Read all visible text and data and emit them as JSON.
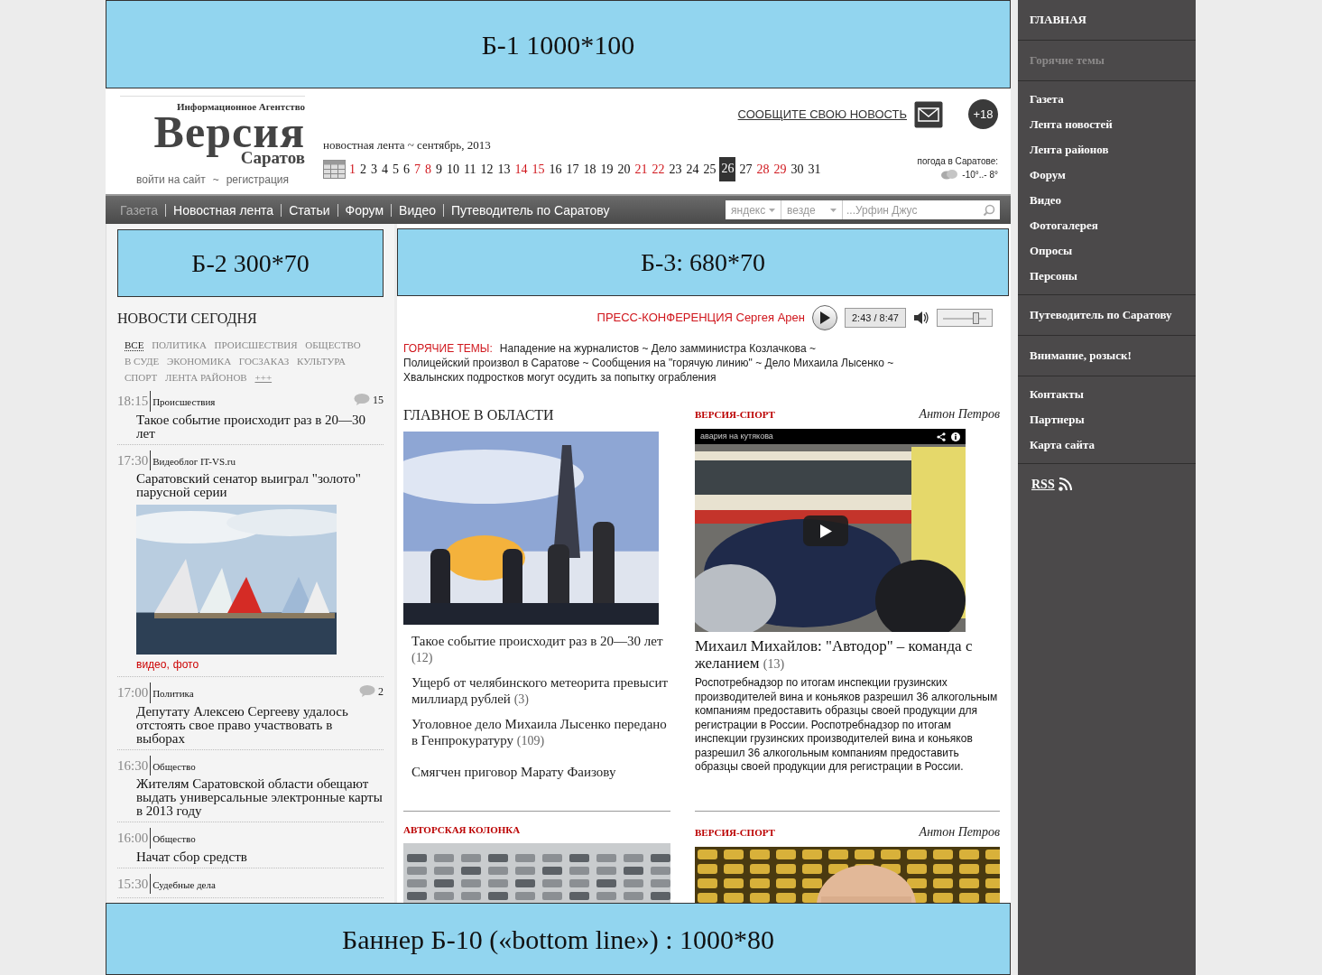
{
  "top_banner": {
    "text": "Б-1  1000*100"
  },
  "header": {
    "logo": {
      "tagline": "Информационное Агентство",
      "name": "Версия",
      "city": "Саратов"
    },
    "login": "войти на сайт",
    "login_separator": "~",
    "register": "регистрация",
    "feed_title": "новостная лента ~ сентябрь, 2013",
    "days": [
      {
        "label": "1",
        "weekend": true,
        "selected": false
      },
      {
        "label": "2",
        "weekend": false,
        "selected": false
      },
      {
        "label": "3",
        "weekend": false,
        "selected": false
      },
      {
        "label": "4",
        "weekend": false,
        "selected": false
      },
      {
        "label": "5",
        "weekend": false,
        "selected": false
      },
      {
        "label": "6",
        "weekend": false,
        "selected": false
      },
      {
        "label": "7",
        "weekend": true,
        "selected": false
      },
      {
        "label": "8",
        "weekend": true,
        "selected": false
      },
      {
        "label": "9",
        "weekend": false,
        "selected": false
      },
      {
        "label": "10",
        "weekend": false,
        "selected": false
      },
      {
        "label": "11",
        "weekend": false,
        "selected": false
      },
      {
        "label": "12",
        "weekend": false,
        "selected": false
      },
      {
        "label": "13",
        "weekend": false,
        "selected": false
      },
      {
        "label": "14",
        "weekend": true,
        "selected": false
      },
      {
        "label": "15",
        "weekend": true,
        "selected": false
      },
      {
        "label": "16",
        "weekend": false,
        "selected": false
      },
      {
        "label": "17",
        "weekend": false,
        "selected": false
      },
      {
        "label": "18",
        "weekend": false,
        "selected": false
      },
      {
        "label": "19",
        "weekend": false,
        "selected": false
      },
      {
        "label": "20",
        "weekend": false,
        "selected": false
      },
      {
        "label": "21",
        "weekend": true,
        "selected": false
      },
      {
        "label": "22",
        "weekend": true,
        "selected": false
      },
      {
        "label": "23",
        "weekend": false,
        "selected": false
      },
      {
        "label": "24",
        "weekend": false,
        "selected": false
      },
      {
        "label": "25",
        "weekend": false,
        "selected": false
      },
      {
        "label": "26",
        "weekend": false,
        "selected": true
      },
      {
        "label": "27",
        "weekend": false,
        "selected": false
      },
      {
        "label": "28",
        "weekend": true,
        "selected": false
      },
      {
        "label": "29",
        "weekend": true,
        "selected": false
      },
      {
        "label": "30",
        "weekend": false,
        "selected": false
      },
      {
        "label": "31",
        "weekend": false,
        "selected": false
      }
    ],
    "report_link": "СООБЩИТЕ СВОЮ НОВОСТЬ",
    "age_badge": "+18",
    "weather": {
      "label": "погода в Саратове:",
      "reading": "-10°..- 8°"
    }
  },
  "nav": {
    "items": [
      {
        "label": "Газета",
        "selected": true
      },
      {
        "label": "Новостная лента",
        "selected": false
      },
      {
        "label": "Статьи",
        "selected": false
      },
      {
        "label": "Форум",
        "selected": false
      },
      {
        "label": "Видео",
        "selected": false
      },
      {
        "label": "Путеводитель по Саратову",
        "selected": false
      }
    ],
    "search": {
      "engine": "яндекс",
      "scope": "везде",
      "placeholder": "...Урфин Джус"
    }
  },
  "left": {
    "banner": "Б-2  300*70",
    "title": "НОВОСТИ СЕГОДНЯ",
    "tags": [
      {
        "label": "ВСЕ",
        "selected": true
      },
      {
        "label": "ПОЛИТИКА",
        "selected": false
      },
      {
        "label": "ПРОИСШЕСТВИЯ",
        "selected": false
      },
      {
        "label": "ОБЩЕСТВО",
        "selected": false
      },
      {
        "label": "В СУДЕ",
        "selected": false
      },
      {
        "label": "ЭКОНОМИКА",
        "selected": false
      },
      {
        "label": "ГОСЗАКАЗ",
        "selected": false
      },
      {
        "label": "КУЛЬТУРА",
        "selected": false
      },
      {
        "label": "СПОРТ",
        "selected": false
      },
      {
        "label": "ЛЕНТА РАЙОНОВ",
        "selected": false
      }
    ],
    "more": "+++",
    "news": [
      {
        "time": "18:15",
        "category": "Происшествия",
        "comments": "15",
        "title": "Такое событие происходит раз в 20—30 лет"
      },
      {
        "time": "17:30",
        "category": "Видеоблог IT-VS.ru",
        "title": "Саратовский сенатор выиграл \"золото\" парусной серии",
        "media": {
          "kind": "picture"
        },
        "links": [
          "видео",
          "фото"
        ],
        "link_separator": ","
      },
      {
        "time": "17:00",
        "category": "Политика",
        "comments": "2",
        "title": "Депутату Алексею Сергееву удалось отстоять свое право участвовать в выборах"
      },
      {
        "time": "16:30",
        "category": "Общество",
        "title": "Жителям Саратовской области обещают выдать универсальные электронные карты в 2013 году"
      },
      {
        "time": "16:00",
        "category": "Общество",
        "title": "Начат сбор средств"
      },
      {
        "time": "15:30",
        "category": "Судебные дела"
      }
    ]
  },
  "center": {
    "banner": "Б-3: 680*70",
    "player": {
      "title": "ПРЕСС-КОНФЕРЕНЦИЯ Сергея Арен",
      "time": "2:43 / 8:47",
      "level": 0.72
    },
    "hot_topics": {
      "label": "ГОРЯЧИЕ ТЕМЫ:",
      "separator": "~",
      "items": [
        "Нападение на журналистов",
        "Дело замминистра Козлачкова",
        "Полицейский произвол в Саратове",
        "Сообщения на \"горячую линию\"",
        "Дело Михаила Лысенко",
        "Хвалынских подростков могут осудить за попытку ограбления"
      ]
    },
    "region": {
      "title": "ГЛАВНОЕ В ОБЛАСТИ",
      "picture": {
        "kind": "picture"
      },
      "headlines": [
        {
          "title": "Такое событие происходит раз в 20—30 лет",
          "count": "(12)"
        },
        {
          "title": "Ущерб от челябинского метеорита превысит миллиард рублей",
          "count": "(3)"
        },
        {
          "title": "Уголовное дело Михаила Лысенко передано в Генпрокуратуру",
          "count": "(109)"
        },
        {
          "title": "Смягчен приговор Марату  Фаизову"
        }
      ]
    },
    "sport": {
      "label": "ВЕРСИЯ-СПОРТ",
      "author": "Антон Петров",
      "video": {
        "title": "авария на кутякова"
      },
      "headline": "Михаил Михайлов: \"Автодор\" – команда с желанием",
      "count": "(13)",
      "text": "Роспотребнадзор по итогам инспекции грузинских производителей вина и коньяков разрешил 36 алкогольным компаниям предоставить образцы своей продукции для регистрации в России. Роспотребнадзор по итогам инспекции грузинских производителей вина и коньяков разрешил 36 алкогольным компаниям предоставить образцы своей продукции для регистрации в России."
    },
    "columns": [
      {
        "label": "АВТОРСКАЯ КОЛОНКА",
        "picture": {
          "kind": "picture"
        }
      },
      {
        "label": "ВЕРСИЯ-СПОРТ",
        "author": "Антон Петров",
        "picture": {
          "kind": "picture"
        }
      }
    ]
  },
  "sidebar": {
    "groups": [
      {
        "items": [
          {
            "label": "ГЛАВНАЯ",
            "selected": false
          }
        ]
      },
      {
        "items": [
          {
            "label": "Горячие темы",
            "selected": true
          }
        ]
      },
      {
        "items": [
          {
            "label": "Газета",
            "selected": false
          },
          {
            "label": "Лента новостей",
            "selected": false
          },
          {
            "label": "Лента районов",
            "selected": false
          },
          {
            "label": "Форум",
            "selected": false
          },
          {
            "label": "Видео",
            "selected": false
          },
          {
            "label": "Фотогалерея",
            "selected": false
          },
          {
            "label": "Опросы",
            "selected": false
          },
          {
            "label": "Персоны",
            "selected": false
          }
        ]
      },
      {
        "items": [
          {
            "label": "Путеводитель по Саратову",
            "selected": false
          }
        ]
      },
      {
        "items": [
          {
            "label": "Внимание, розыск!",
            "selected": false
          }
        ]
      },
      {
        "items": [
          {
            "label": "Контакты",
            "selected": false
          },
          {
            "label": "Партнеры",
            "selected": false
          },
          {
            "label": "Карта сайта",
            "selected": false
          }
        ]
      }
    ],
    "rss": "RSS"
  },
  "bottom_banner": {
    "text": "Баннер Б-10 («bottom line») : 1000*80"
  }
}
